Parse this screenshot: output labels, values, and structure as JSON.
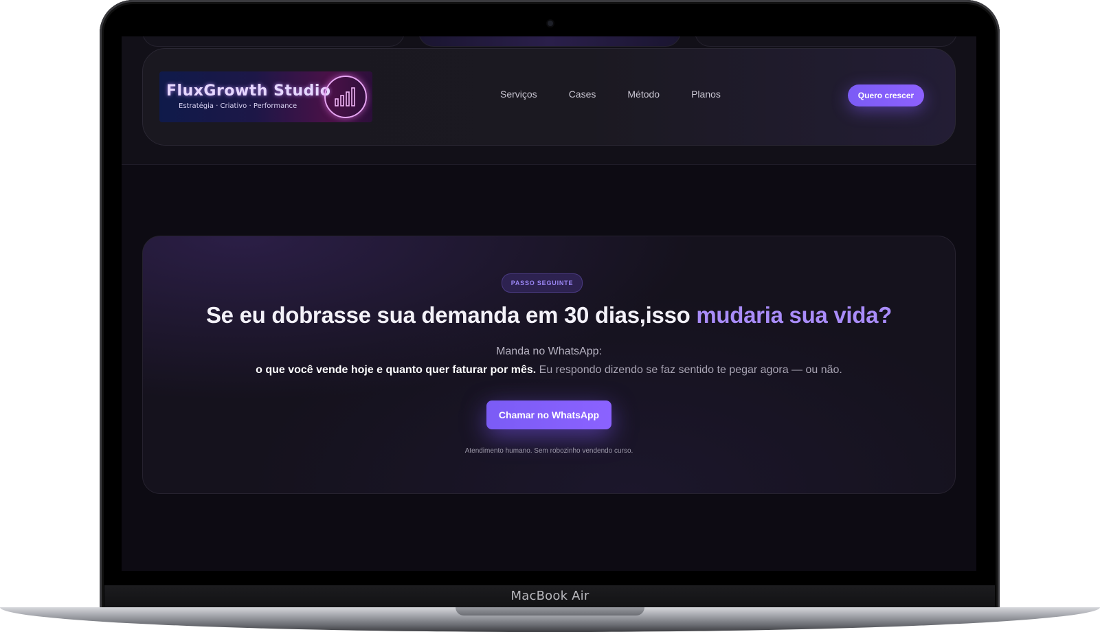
{
  "device": {
    "label": "MacBook Air"
  },
  "header": {
    "logo": {
      "title": "FluxGrowth Studio",
      "subtitle": "Estratégia · Criativo · Performance"
    },
    "nav": [
      {
        "label": "Serviços"
      },
      {
        "label": "Cases"
      },
      {
        "label": "Método"
      },
      {
        "label": "Planos"
      }
    ],
    "cta_label": "Quero crescer"
  },
  "hero": {
    "badge": "PASSO SEGUINTE",
    "headline_main": "Se eu dobrasse sua demanda em 30 dias,isso ",
    "headline_accent": "mudaria sua vida?",
    "line1": "Manda no WhatsApp:",
    "line2_bold": "o que você vende hoje e quanto quer faturar por mês.",
    "line2_rest": " Eu respondo dizendo se faz sentido te pegar agora — ou não.",
    "cta_label": "Chamar no WhatsApp",
    "footnote": "Atendimento humano. Sem robozinho vendendo curso."
  },
  "colors": {
    "accent": "#8d61ff",
    "accent_text": "#a98cf9",
    "background": "#0d0b13"
  },
  "icons": {
    "logo_badge": "bar-chart-icon"
  }
}
